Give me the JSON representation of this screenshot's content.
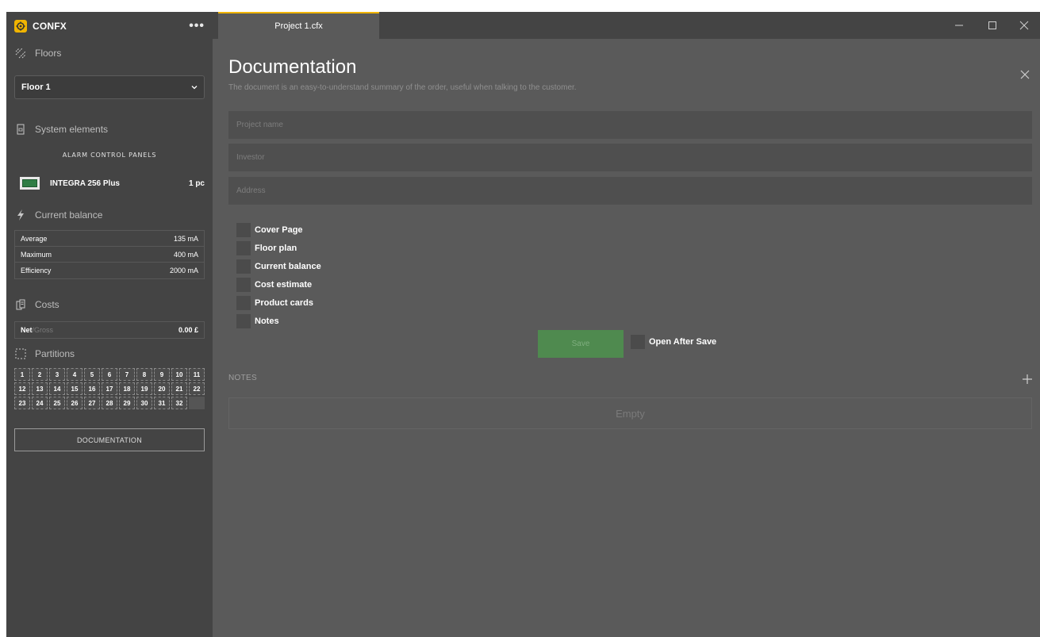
{
  "app": {
    "brand": "CONFX",
    "more_label": "•••",
    "tab_title": "Project 1.cfx",
    "window_controls": [
      "minimize-icon",
      "maximize-icon",
      "close-icon"
    ]
  },
  "sidebar": {
    "floors": {
      "heading": "Floors",
      "selected": "Floor 1"
    },
    "system_elements": {
      "heading": "System elements",
      "group_label": "ALARM CONTROL PANELS",
      "device": {
        "name": "INTEGRA 256 Plus",
        "qty": "1 pc"
      }
    },
    "current_balance": {
      "heading": "Current balance",
      "rows": [
        {
          "label": "Average",
          "value": "135 mA"
        },
        {
          "label": "Maximum",
          "value": "400 mA"
        },
        {
          "label": "Efficiency",
          "value": "2000 mA"
        }
      ]
    },
    "costs": {
      "heading": "Costs",
      "net": "Net",
      "sep": "/",
      "gross": "Gross",
      "amount": "0.00 £"
    },
    "partitions": {
      "heading": "Partitions",
      "items": [
        "1",
        "2",
        "3",
        "4",
        "5",
        "6",
        "7",
        "8",
        "9",
        "10",
        "11",
        "12",
        "13",
        "14",
        "15",
        "16",
        "17",
        "18",
        "19",
        "20",
        "21",
        "22",
        "23",
        "24",
        "25",
        "26",
        "27",
        "28",
        "29",
        "30",
        "31",
        "32"
      ]
    },
    "documentation_button": "DOCUMENTATION"
  },
  "main": {
    "title": "Documentation",
    "subtitle": "The document is an easy-to-understand summary of the order, useful when talking to the customer.",
    "fields": [
      {
        "placeholder": "Project name"
      },
      {
        "placeholder": "Investor"
      },
      {
        "placeholder": "Address"
      }
    ],
    "checkboxes": [
      "Cover Page",
      "Floor plan",
      "Current balance",
      "Cost estimate",
      "Product cards",
      "Notes"
    ],
    "save_label": "Save",
    "open_after_save": "Open After Save",
    "notes": {
      "label": "NOTES",
      "empty": "Empty"
    }
  },
  "colors": {
    "accent": "#f0b400",
    "save": "#4f8a4f",
    "sidebar": "#444444",
    "content": "#5a5a5a"
  }
}
